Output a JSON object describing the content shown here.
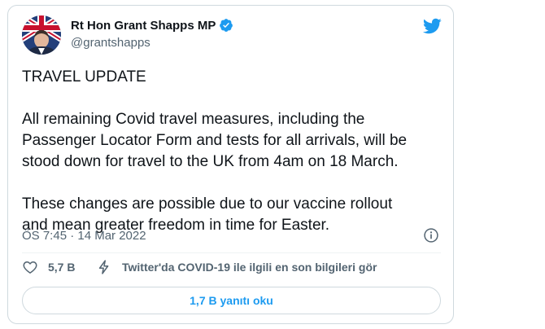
{
  "author": {
    "display_name": "Rt Hon Grant Shapps MP",
    "handle": "@grantshapps",
    "verified": true
  },
  "tweet": {
    "text": "TRAVEL UPDATE\n\nAll remaining Covid travel measures, including the\nPassenger Locator Form and tests for all arrivals, will be\nstood down for travel to the UK from 4am on 18 March.\n\nThese changes are possible due to our vaccine rollout\nand mean greater freedom in time for Easter.",
    "timestamp": "ÖS 7:45 · 14 Mar 2022"
  },
  "actions": {
    "like_count": "5,7 B",
    "covid_info_label": "Twitter'da COVID-19 ile ilgili en son bilgileri gör",
    "read_replies_label": "1,7 B yanıtı oku"
  },
  "icons": {
    "avatar": "profile-photo",
    "verified": "verified-badge-icon",
    "brand": "twitter-bird-icon",
    "info": "info-icon",
    "like": "heart-icon",
    "covid": "lightning-bolt-icon"
  },
  "colors": {
    "accent": "#1d9bf0",
    "text_primary": "#0f1419",
    "text_secondary": "#536471",
    "border": "#cfd9de"
  }
}
